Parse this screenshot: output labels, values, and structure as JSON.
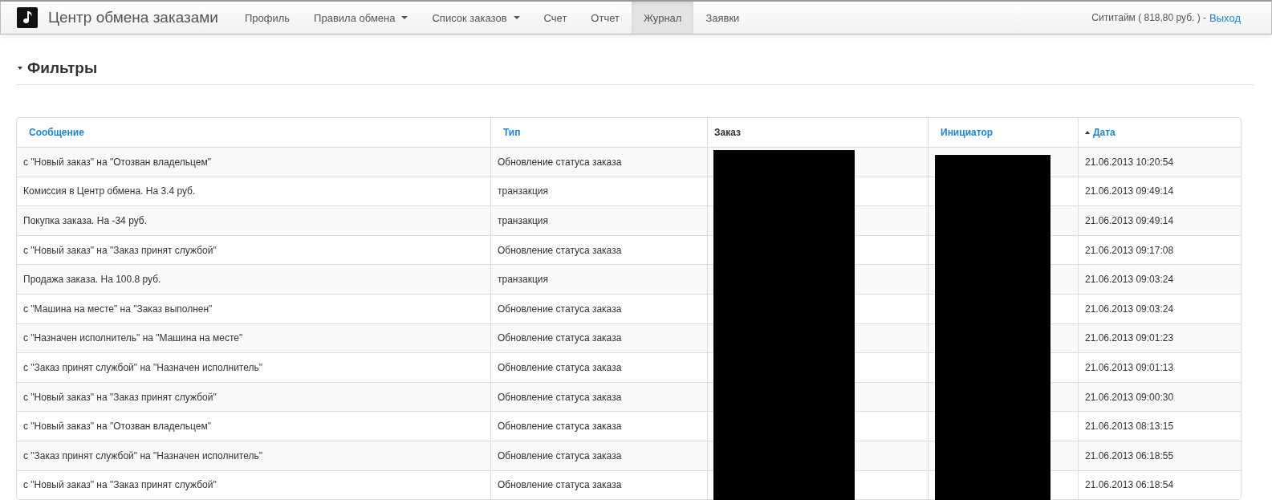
{
  "navbar": {
    "brand": "Центр обмена заказами",
    "items": [
      {
        "label": "Профиль",
        "dropdown": false,
        "selected": false
      },
      {
        "label": "Правила обмена",
        "dropdown": true,
        "selected": false
      },
      {
        "label": "Список заказов",
        "dropdown": true,
        "selected": false
      },
      {
        "label": "Счет",
        "dropdown": false,
        "selected": false
      },
      {
        "label": "Отчет",
        "dropdown": false,
        "selected": false
      },
      {
        "label": "Журнал",
        "dropdown": false,
        "selected": true
      },
      {
        "label": "Заявки",
        "dropdown": false,
        "selected": false
      }
    ],
    "account": "Сититайм ( 818,80 руб. ) -",
    "logout": "Выход"
  },
  "filters": {
    "title": "Фильтры",
    "expanded": false
  },
  "table": {
    "columns": [
      {
        "label": "Сообщение",
        "link": true,
        "sorted": false
      },
      {
        "label": "Тип",
        "link": true,
        "sorted": false
      },
      {
        "label": "Заказ",
        "link": false,
        "sorted": false
      },
      {
        "label": "Инициатор",
        "link": true,
        "sorted": false
      },
      {
        "label": "Дата",
        "link": true,
        "sorted": true
      }
    ],
    "rows": [
      {
        "message": "с \"Новый заказ\" на \"Отозван владельцем\"",
        "type": "Обновление статуса заказа",
        "date": "21.06.2013 10:20:54"
      },
      {
        "message": "Комиссия в Центр обмена. На 3.4 руб.",
        "type": "транзакция",
        "date": "21.06.2013 09:49:14"
      },
      {
        "message": "Покупка заказа. На -34 руб.",
        "type": "транзакция",
        "date": "21.06.2013 09:49:14"
      },
      {
        "message": "с \"Новый заказ\" на \"Заказ принят службой\"",
        "type": "Обновление статуса заказа",
        "date": "21.06.2013 09:17:08"
      },
      {
        "message": "Продажа заказа. На 100.8 руб.",
        "type": "транзакция",
        "date": "21.06.2013 09:03:24"
      },
      {
        "message": "с \"Машина на месте\" на \"Заказ выполнен\"",
        "type": "Обновление статуса заказа",
        "date": "21.06.2013 09:03:24"
      },
      {
        "message": "с \"Назначен исполнитель\" на \"Машина на месте\"",
        "type": "Обновление статуса заказа",
        "date": "21.06.2013 09:01:23"
      },
      {
        "message": "с \"Заказ принят службой\" на \"Назначен исполнитель\"",
        "type": "Обновление статуса заказа",
        "date": "21.06.2013 09:01:13"
      },
      {
        "message": "с \"Новый заказ\" на \"Заказ принят службой\"",
        "type": "Обновление статуса заказа",
        "date": "21.06.2013 09:00:30"
      },
      {
        "message": "с \"Новый заказ\" на \"Отозван владельцем\"",
        "type": "Обновление статуса заказа",
        "date": "21.06.2013 08:13:15"
      },
      {
        "message": "с \"Заказ принят службой\" на \"Назначен исполнитель\"",
        "type": "Обновление статуса заказа",
        "date": "21.06.2013 06:18:55"
      },
      {
        "message": "с \"Новый заказ\" на \"Заказ принят службой\"",
        "type": "Обновление статуса заказа",
        "date": "21.06.2013 06:18:54"
      }
    ]
  }
}
